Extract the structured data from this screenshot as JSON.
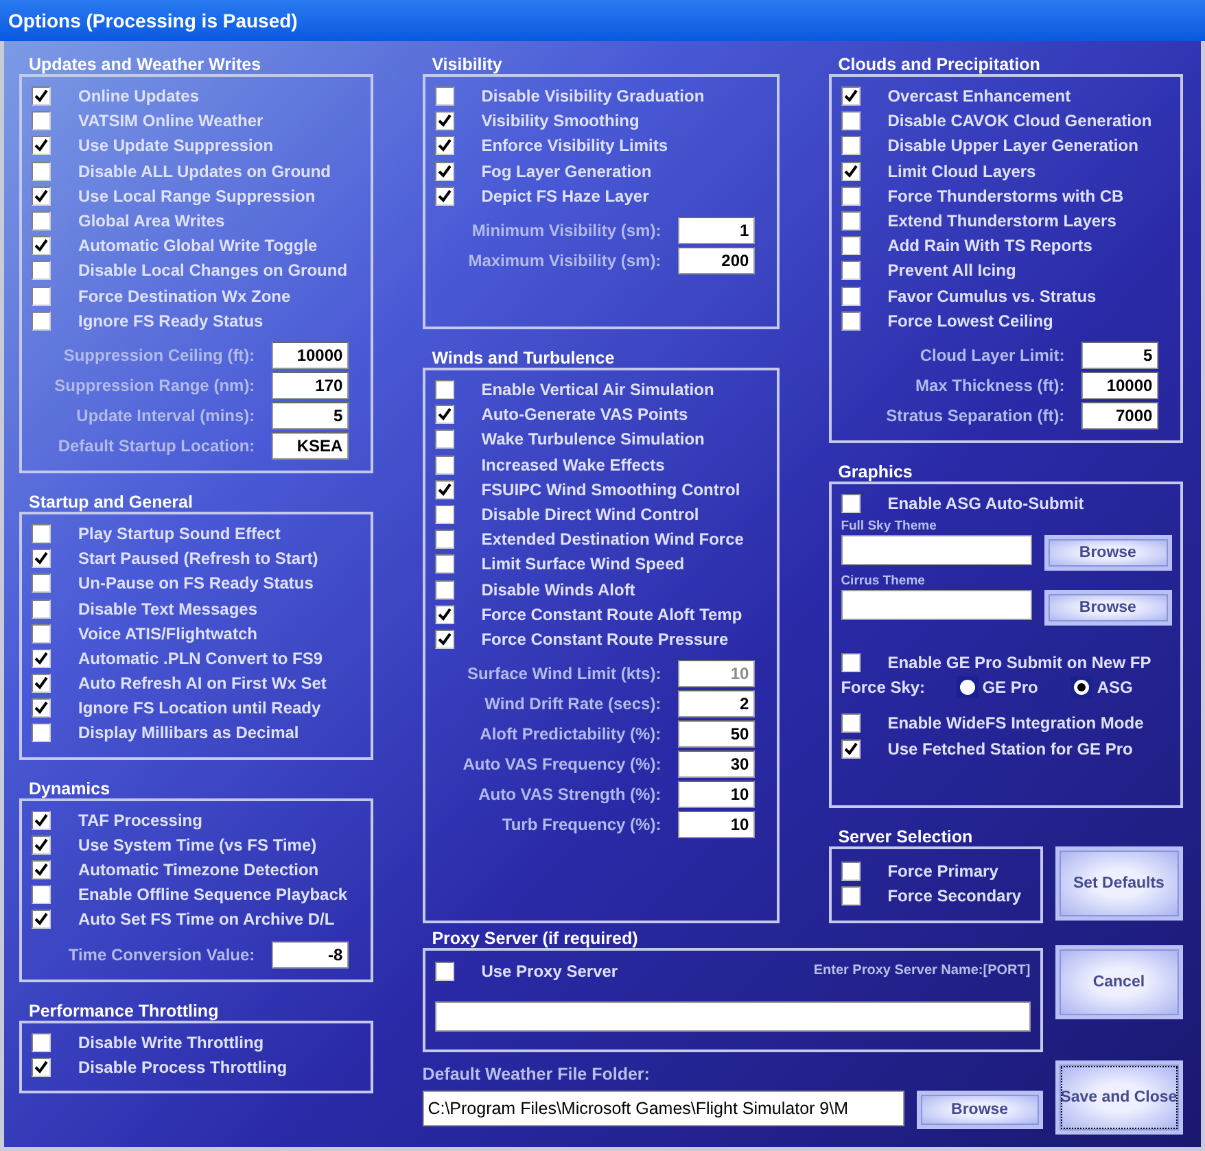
{
  "window": {
    "title": "Options (Processing is Paused)"
  },
  "left": [
    {
      "title": "Updates and Weather Writes",
      "checkboxes": [
        {
          "label": "Online Updates",
          "checked": true
        },
        {
          "label": "VATSIM Online Weather",
          "checked": false
        },
        {
          "label": "Use Update Suppression",
          "checked": true
        },
        {
          "label": "Disable ALL Updates on Ground",
          "checked": false
        },
        {
          "label": "Use Local Range Suppression",
          "checked": true
        },
        {
          "label": "Global Area Writes",
          "checked": false
        },
        {
          "label": "Automatic Global Write Toggle",
          "checked": true
        },
        {
          "label": "Disable Local Changes on Ground",
          "checked": false
        },
        {
          "label": "Force Destination Wx Zone",
          "checked": false
        },
        {
          "label": "Ignore FS Ready Status",
          "checked": false
        }
      ],
      "fields": [
        {
          "label": "Suppression Ceiling (ft):",
          "value": "10000",
          "disabled": false
        },
        {
          "label": "Suppression Range (nm):",
          "value": "170",
          "disabled": false
        },
        {
          "label": "Update Interval (mins):",
          "value": "5",
          "disabled": false
        },
        {
          "label": "Default Startup Location:",
          "value": "KSEA",
          "disabled": false
        }
      ]
    },
    {
      "title": "Startup and General",
      "checkboxes": [
        {
          "label": "Play Startup Sound Effect",
          "checked": false
        },
        {
          "label": "Start Paused (Refresh to Start)",
          "checked": true
        },
        {
          "label": "Un-Pause on FS Ready Status",
          "checked": false
        },
        {
          "label": "Disable Text Messages",
          "checked": false
        },
        {
          "label": "Voice ATIS/Flightwatch",
          "checked": false
        },
        {
          "label": "Automatic .PLN Convert to FS9",
          "checked": true
        },
        {
          "label": "Auto Refresh AI on First Wx Set",
          "checked": true
        },
        {
          "label": "Ignore FS Location until Ready",
          "checked": true
        },
        {
          "label": "Display Millibars as Decimal",
          "checked": false
        }
      ]
    },
    {
      "title": "Dynamics",
      "checkboxes": [
        {
          "label": "TAF Processing",
          "checked": true
        },
        {
          "label": "Use System Time (vs FS Time)",
          "checked": true
        },
        {
          "label": "Automatic Timezone Detection",
          "checked": true
        },
        {
          "label": "Enable Offline Sequence Playback",
          "checked": false
        },
        {
          "label": "Auto Set FS Time on Archive D/L",
          "checked": true
        }
      ],
      "fields": [
        {
          "label": "Time Conversion Value:",
          "value": "-8",
          "disabled": false
        }
      ]
    },
    {
      "title": "Performance Throttling",
      "checkboxes": [
        {
          "label": "Disable Write Throttling",
          "checked": false
        },
        {
          "label": "Disable Process Throttling",
          "checked": true
        }
      ]
    }
  ],
  "middle": [
    {
      "title": "Visibility",
      "checkboxes": [
        {
          "label": "Disable Visibility Graduation",
          "checked": false
        },
        {
          "label": "Visibility Smoothing",
          "checked": true
        },
        {
          "label": "Enforce Visibility Limits",
          "checked": true
        },
        {
          "label": "Fog Layer Generation",
          "checked": true
        },
        {
          "label": "Depict FS Haze Layer",
          "checked": true
        }
      ],
      "fields": [
        {
          "label": "Minimum Visibility (sm):",
          "value": "1",
          "disabled": false
        },
        {
          "label": "Maximum Visibility (sm):",
          "value": "200",
          "disabled": false
        }
      ]
    },
    {
      "title": "Winds and Turbulence",
      "checkboxes": [
        {
          "label": "Enable Vertical Air Simulation",
          "checked": false
        },
        {
          "label": "Auto-Generate VAS Points",
          "checked": true
        },
        {
          "label": "Wake Turbulence Simulation",
          "checked": false
        },
        {
          "label": "Increased Wake Effects",
          "checked": false
        },
        {
          "label": "FSUIPC Wind Smoothing Control",
          "checked": true
        },
        {
          "label": "Disable Direct Wind Control",
          "checked": false
        },
        {
          "label": "Extended Destination Wind Force",
          "checked": false
        },
        {
          "label": "Limit Surface Wind Speed",
          "checked": false
        },
        {
          "label": "Disable Winds Aloft",
          "checked": false
        },
        {
          "label": "Force Constant Route Aloft Temp",
          "checked": true
        },
        {
          "label": "Force Constant Route Pressure",
          "checked": true
        }
      ],
      "fields": [
        {
          "label": "Surface Wind Limit (kts):",
          "value": "10",
          "disabled": true
        },
        {
          "label": "Wind Drift Rate (secs):",
          "value": "2",
          "disabled": false
        },
        {
          "label": "Aloft Predictability (%):",
          "value": "50",
          "disabled": false
        },
        {
          "label": "Auto VAS Frequency (%):",
          "value": "30",
          "disabled": false
        },
        {
          "label": "Auto VAS Strength (%):",
          "value": "10",
          "disabled": false
        },
        {
          "label": "Turb Frequency (%):",
          "value": "10",
          "disabled": false
        }
      ]
    }
  ],
  "clouds": {
    "title": "Clouds and Precipitation",
    "checkboxes": [
      {
        "label": "Overcast Enhancement",
        "checked": true
      },
      {
        "label": "Disable CAVOK Cloud Generation",
        "checked": false
      },
      {
        "label": "Disable Upper Layer Generation",
        "checked": false
      },
      {
        "label": "Limit Cloud Layers",
        "checked": true
      },
      {
        "label": "Force Thunderstorms with CB",
        "checked": false
      },
      {
        "label": "Extend Thunderstorm Layers",
        "checked": false
      },
      {
        "label": "Add Rain With TS Reports",
        "checked": false
      },
      {
        "label": "Prevent All Icing",
        "checked": false
      },
      {
        "label": "Favor Cumulus vs. Stratus",
        "checked": false
      },
      {
        "label": "Force Lowest Ceiling",
        "checked": false
      }
    ],
    "fields": [
      {
        "label": "Cloud Layer Limit:",
        "value": "5",
        "disabled": false
      },
      {
        "label": "Max Thickness (ft):",
        "value": "10000",
        "disabled": false
      },
      {
        "label": "Stratus Separation (ft):",
        "value": "7000",
        "disabled": false
      }
    ]
  },
  "graphics": {
    "title": "Graphics",
    "asg_submit": {
      "label": "Enable ASG Auto-Submit",
      "checked": false
    },
    "themes": [
      {
        "label": "Full Sky Theme",
        "button": "Browse"
      },
      {
        "label": "Cirrus Theme",
        "button": "Browse"
      }
    ],
    "ge_submit": {
      "label": "Enable GE Pro Submit on New FP",
      "checked": false
    },
    "force_sky": {
      "label": "Force Sky:",
      "options": [
        {
          "label": "GE Pro",
          "selected": false
        },
        {
          "label": "ASG",
          "selected": true
        }
      ]
    },
    "checkboxes": [
      {
        "label": "Enable WideFS Integration Mode",
        "checked": false
      },
      {
        "label": "Use Fetched Station for GE Pro",
        "checked": true
      }
    ]
  },
  "server": {
    "title": "Server Selection",
    "checkboxes": [
      {
        "label": "Force Primary",
        "checked": false
      },
      {
        "label": "Force Secondary",
        "checked": false
      }
    ]
  },
  "proxy": {
    "title": "Proxy Server (if required)",
    "checkbox": {
      "label": "Use Proxy Server",
      "checked": false
    },
    "hint": "Enter Proxy Server Name:[PORT]"
  },
  "folder": {
    "label": "Default Weather File Folder:",
    "value": "C:\\Program Files\\Microsoft Games\\Flight Simulator 9\\M",
    "button": "Browse"
  },
  "buttons": {
    "set_defaults": {
      "label": "Set Defaults",
      "focused": false
    },
    "cancel": {
      "label": "Cancel",
      "focused": false
    },
    "save_close": {
      "label": "Save and Close",
      "focused": true
    }
  }
}
